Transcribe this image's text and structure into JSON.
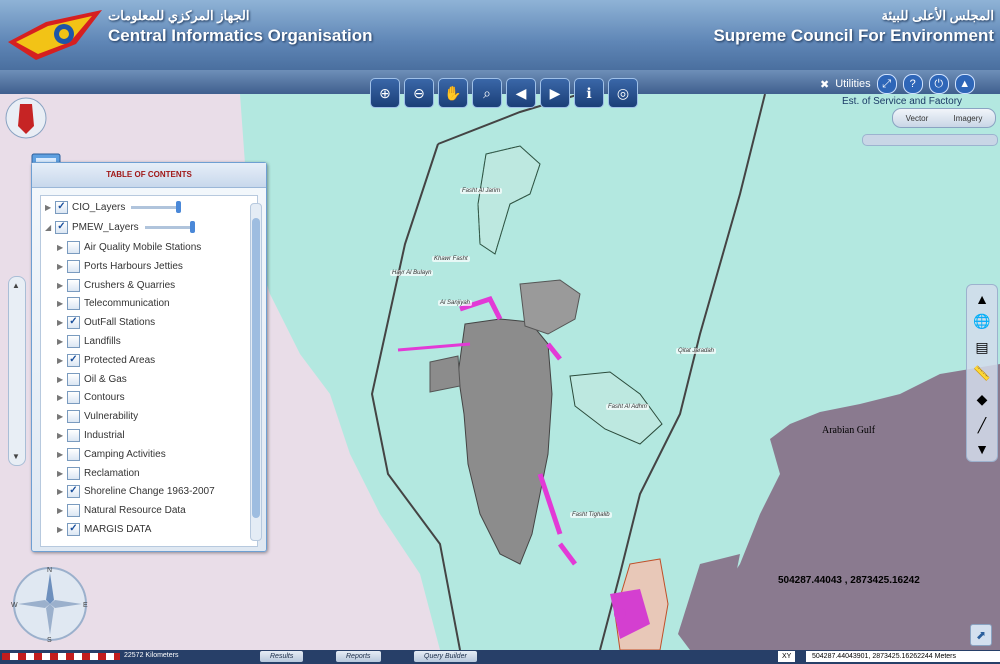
{
  "header": {
    "left_arabic": "الجهاز المركزي للمعلومات",
    "left_english": "Central Informatics Organisation",
    "right_arabic": "المجلس الأعلى للبيئة",
    "right_english": "Supreme Council For Environment"
  },
  "toolbar": {
    "tools": [
      "zoom-in",
      "zoom-out",
      "pan",
      "full-extent",
      "previous-extent",
      "next-extent",
      "identify",
      "globe"
    ],
    "utilities_label": "Utilities"
  },
  "right_panel": {
    "est_label": "Est. of Service and Factory",
    "vector_label": "Vector",
    "imagery_label": "Imagery"
  },
  "toc": {
    "title": "TABLE OF CONTENTS",
    "groups": [
      {
        "label": "CIO_Layers",
        "checked": true
      },
      {
        "label": "PMEW_Layers",
        "checked": true
      }
    ],
    "layers": [
      {
        "label": "Air Quality Mobile Stations",
        "checked": false
      },
      {
        "label": "Ports Harbours Jetties",
        "checked": false
      },
      {
        "label": "Crushers & Quarries",
        "checked": false
      },
      {
        "label": "Telecommunication",
        "checked": false
      },
      {
        "label": "OutFall Stations",
        "checked": true
      },
      {
        "label": "Landfills",
        "checked": false
      },
      {
        "label": "Protected Areas",
        "checked": true
      },
      {
        "label": "Oil & Gas",
        "checked": false
      },
      {
        "label": "Contours",
        "checked": false
      },
      {
        "label": "Vulnerability",
        "checked": false
      },
      {
        "label": "Industrial",
        "checked": false
      },
      {
        "label": "Camping Activities",
        "checked": false
      },
      {
        "label": "Reclamation",
        "checked": false
      },
      {
        "label": "Shoreline Change 1963-2007",
        "checked": true
      },
      {
        "label": "Natural Resource Data",
        "checked": false
      },
      {
        "label": "MARGIS DATA",
        "checked": true
      }
    ]
  },
  "map": {
    "sea_label": "Arabian Gulf",
    "cursor_coordinates": "504287.44043 , 2873425.16242",
    "place_labels": [
      {
        "text": "Fasht Al Jarim"
      },
      {
        "text": "Khawr Fasht"
      },
      {
        "text": "Hayr Al Bulayn"
      },
      {
        "text": "Al Sanjiyah"
      },
      {
        "text": "Qitat Jaradah"
      },
      {
        "text": "Fasht Al Adhm"
      },
      {
        "text": "Fasht Tighalib"
      }
    ],
    "colors": {
      "sea": "#b3e8e0",
      "land_east": "#8a7a8f",
      "land_west": "#e9dde8",
      "island": "#8c8c8c",
      "protected": "#e23ad6"
    }
  },
  "status_bar": {
    "scale_text": "22572 Kilometers",
    "results_label": "Results",
    "reports_label": "Reports",
    "query_builder_label": "Query Builder",
    "xy_label": "XY",
    "coordinates": "504287.44043901, 2873425.16262244 Meters"
  }
}
